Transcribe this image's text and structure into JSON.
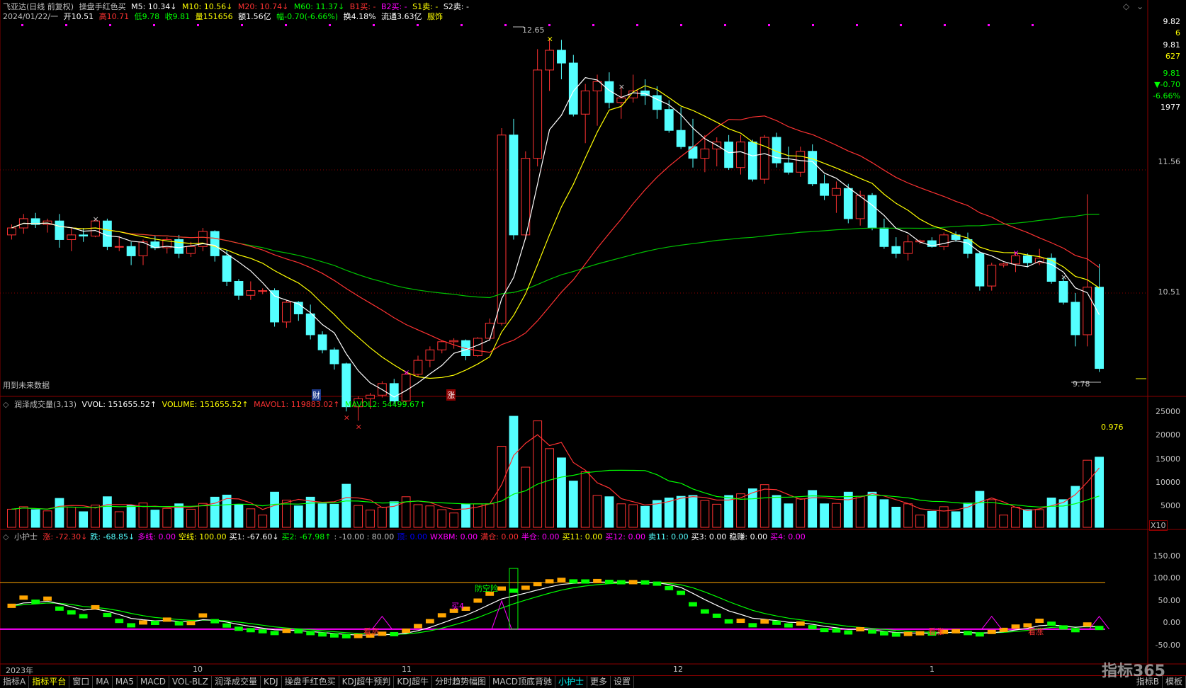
{
  "colors": {
    "up": "#ff3232",
    "down": "#54ffff",
    "ma5": "#ffffff",
    "ma10": "#ffff00",
    "ma20": "#ff3232",
    "ma60": "#00c000",
    "grid": "#8b0000",
    "orange": "#ffa500",
    "green": "#00ff00",
    "magenta": "#ff00ff"
  },
  "header": {
    "stock": "飞亚达(日线 前复权)",
    "indicator_name": "操盘手红色买",
    "ma5": "M5: 10.34↓",
    "ma10": "M10: 10.56↓",
    "ma20": "M20: 10.74↓",
    "ma60": "M60: 11.37↓",
    "b1": "B1买: -",
    "b2": "B2买: -",
    "s1": "S1卖: -",
    "s2": "S2卖: -",
    "date": "2024/01/22/一",
    "open": "开10.51",
    "high": "高10.71",
    "low": "低9.78",
    "close": "收9.81",
    "volume": "量151656",
    "amount": "额1.56亿",
    "change": "幅-0.70(-6.66%)",
    "turnover": "换4.18%",
    "float": "流通3.63亿",
    "sector": "服饰"
  },
  "right_panel": {
    "v1": "9.82",
    "v2": "6",
    "v3": "9.81",
    "v4": "627",
    "v5": "9.81",
    "v6": "▼-0.70",
    "v7": "-6.66%",
    "v8": "1977"
  },
  "price_axis": [
    "11.56",
    "10.51"
  ],
  "annotations": {
    "high_label": "12.65",
    "low_label": "9.78",
    "future_data": "用到未来数据",
    "cai_label": "财",
    "zhang_label": "涨"
  },
  "volume_panel": {
    "title": "润泽成交量(3,13)",
    "vvol": "VVOL: 151655.52↑",
    "volume": "VOLUME: 151655.52↑",
    "mavol1": "MAVOL1: 119883.02↑",
    "mavol2": "MAVOL2: 54499.67↑",
    "ratio": "0.976",
    "axis": [
      "25000",
      "20000",
      "15000",
      "10000",
      "5000"
    ],
    "unit": "X10"
  },
  "guard_panel": {
    "title": "小护士",
    "items": [
      {
        "text": "涨: -72.30↓",
        "color": "#ff3232"
      },
      {
        "text": "跌: -68.85↓",
        "color": "#54ffff"
      },
      {
        "text": "多线: 0.00",
        "color": "#ff00ff"
      },
      {
        "text": "空线: 100.00",
        "color": "#ffff00"
      },
      {
        "text": "买1: -67.60↓",
        "color": "#ffffff"
      },
      {
        "text": "买2: -67.98↑",
        "color": "#00ff00"
      },
      {
        "text": ": -10.00 : 80.00",
        "color": "#c0c0c0"
      },
      {
        "text": "顶: 0.00",
        "color": "#0000ff"
      },
      {
        "text": "WXBM: 0.00",
        "color": "#ff00ff"
      },
      {
        "text": "满仓: 0.00",
        "color": "#ff3232"
      },
      {
        "text": "半仓: 0.00",
        "color": "#ff00ff"
      },
      {
        "text": "买11: 0.00",
        "color": "#ffff00"
      },
      {
        "text": "买12: 0.00",
        "color": "#ff00ff"
      },
      {
        "text": "卖11: 0.00",
        "color": "#54ffff"
      },
      {
        "text": "买3: 0.00",
        "color": "#ffffff"
      },
      {
        "text": "稳赚: 0.00",
        "color": "#ffffff"
      },
      {
        "text": "买4: 0.00",
        "color": "#ff00ff"
      }
    ],
    "axis": [
      "150.00",
      "100.00",
      "50.00",
      "0.00",
      "-50.00"
    ],
    "labels": {
      "kanzhang": "看涨",
      "fangxian": "防空险",
      "jixiang": "买4"
    }
  },
  "date_axis": [
    "2023年",
    "10",
    "11",
    "12",
    "1"
  ],
  "tabs": [
    {
      "label": "指标A"
    },
    {
      "label": "指标平台"
    },
    {
      "label": "窗口"
    },
    {
      "label": "MA"
    },
    {
      "label": "MA5"
    },
    {
      "label": "MACD"
    },
    {
      "label": "VOL-BLZ"
    },
    {
      "label": "润泽成交量"
    },
    {
      "label": "KDJ"
    },
    {
      "label": "操盘手红色买"
    },
    {
      "label": "KDJ超牛预判"
    },
    {
      "label": "KDJ超牛"
    },
    {
      "label": "分时趋势幅图"
    },
    {
      "label": "MACD顶底背驰"
    },
    {
      "label": "小护士"
    },
    {
      "label": "更多"
    },
    {
      "label": "设置"
    }
  ],
  "tabs_right": {
    "b": "指标B",
    "template": "模板"
  },
  "watermark": "指标365",
  "chart_data": {
    "type": "candlestick",
    "price_range": [
      9.6,
      12.8
    ],
    "candles": [
      [
        10.96,
        11.05,
        10.92,
        11.02
      ],
      [
        11.02,
        11.14,
        10.97,
        11.1
      ],
      [
        11.1,
        11.15,
        11.02,
        11.05
      ],
      [
        11.05,
        11.1,
        10.98,
        11.08
      ],
      [
        11.08,
        11.14,
        10.85,
        10.92
      ],
      [
        10.92,
        11.02,
        10.82,
        10.96
      ],
      [
        10.96,
        11.02,
        10.9,
        10.95
      ],
      [
        10.95,
        11.1,
        10.94,
        11.08
      ],
      [
        11.08,
        11.1,
        10.83,
        10.86
      ],
      [
        10.86,
        10.95,
        10.82,
        10.86
      ],
      [
        10.86,
        10.9,
        10.7,
        10.78
      ],
      [
        10.78,
        10.92,
        10.7,
        10.9
      ],
      [
        10.9,
        10.95,
        10.83,
        10.85
      ],
      [
        10.85,
        10.94,
        10.8,
        10.92
      ],
      [
        10.92,
        10.96,
        10.76,
        10.8
      ],
      [
        10.8,
        10.9,
        10.77,
        10.86
      ],
      [
        10.86,
        11.02,
        10.82,
        10.99
      ],
      [
        10.99,
        11.0,
        10.73,
        10.78
      ],
      [
        10.78,
        10.83,
        10.52,
        10.56
      ],
      [
        10.56,
        10.58,
        10.4,
        10.44
      ],
      [
        10.44,
        10.56,
        10.4,
        10.48
      ],
      [
        10.48,
        10.5,
        10.45,
        10.48
      ],
      [
        10.48,
        10.5,
        10.17,
        10.21
      ],
      [
        10.21,
        10.4,
        10.16,
        10.38
      ],
      [
        10.38,
        10.39,
        10.22,
        10.28
      ],
      [
        10.28,
        10.36,
        10.06,
        10.1
      ],
      [
        10.1,
        10.13,
        9.94,
        9.97
      ],
      [
        9.97,
        9.99,
        9.8,
        9.85
      ],
      [
        9.85,
        9.86,
        9.44,
        9.48
      ],
      [
        9.48,
        9.57,
        9.36,
        9.55
      ],
      [
        9.55,
        9.6,
        9.46,
        9.58
      ],
      [
        9.58,
        9.7,
        9.56,
        9.68
      ],
      [
        9.68,
        9.72,
        9.5,
        9.53
      ],
      [
        9.53,
        9.78,
        9.52,
        9.76
      ],
      [
        9.76,
        9.92,
        9.74,
        9.88
      ],
      [
        9.88,
        10.0,
        9.82,
        9.97
      ],
      [
        9.97,
        10.05,
        9.94,
        10.04
      ],
      [
        10.04,
        10.07,
        9.98,
        10.05
      ],
      [
        10.05,
        10.06,
        9.88,
        9.92
      ],
      [
        9.92,
        10.08,
        9.91,
        10.07
      ],
      [
        10.07,
        10.24,
        10.05,
        10.2
      ],
      [
        10.2,
        11.88,
        10.18,
        11.82
      ],
      [
        11.82,
        11.96,
        10.92,
        10.96
      ],
      [
        10.96,
        11.68,
        10.92,
        11.62
      ],
      [
        11.62,
        12.56,
        11.55,
        12.38
      ],
      [
        12.38,
        12.65,
        12.2,
        12.55
      ],
      [
        12.55,
        12.64,
        12.3,
        12.44
      ],
      [
        12.44,
        12.51,
        11.98,
        12.0
      ],
      [
        12.0,
        12.26,
        11.75,
        12.2
      ],
      [
        12.2,
        12.34,
        11.9,
        12.28
      ],
      [
        12.28,
        12.36,
        12.05,
        12.1
      ],
      [
        12.1,
        12.24,
        11.96,
        12.14
      ],
      [
        12.14,
        12.34,
        12.1,
        12.2
      ],
      [
        12.2,
        12.3,
        12.08,
        12.16
      ],
      [
        12.16,
        12.24,
        11.96,
        12.04
      ],
      [
        12.04,
        12.12,
        11.84,
        11.86
      ],
      [
        11.86,
        12.06,
        11.7,
        11.72
      ],
      [
        11.72,
        11.96,
        11.54,
        11.62
      ],
      [
        11.62,
        11.82,
        11.5,
        11.7
      ],
      [
        11.7,
        11.8,
        11.55,
        11.76
      ],
      [
        11.76,
        11.82,
        11.52,
        11.54
      ],
      [
        11.54,
        11.82,
        11.48,
        11.76
      ],
      [
        11.76,
        11.78,
        11.42,
        11.44
      ],
      [
        11.44,
        11.82,
        11.4,
        11.8
      ],
      [
        11.8,
        11.84,
        11.54,
        11.58
      ],
      [
        11.58,
        11.72,
        11.48,
        11.5
      ],
      [
        11.5,
        11.72,
        11.46,
        11.68
      ],
      [
        11.68,
        11.74,
        11.38,
        11.4
      ],
      [
        11.4,
        11.48,
        11.26,
        11.3
      ],
      [
        11.3,
        11.42,
        11.15,
        11.36
      ],
      [
        11.36,
        11.4,
        11.06,
        11.1
      ],
      [
        11.1,
        11.34,
        11.04,
        11.3
      ],
      [
        11.3,
        11.32,
        11.0,
        11.02
      ],
      [
        11.02,
        11.1,
        10.84,
        10.86
      ],
      [
        10.86,
        10.94,
        10.76,
        10.8
      ],
      [
        10.8,
        10.96,
        10.74,
        10.9
      ],
      [
        10.9,
        10.92,
        10.88,
        10.91
      ],
      [
        10.91,
        10.94,
        10.85,
        10.86
      ],
      [
        10.86,
        10.98,
        10.83,
        10.96
      ],
      [
        10.96,
        10.99,
        10.9,
        10.92
      ],
      [
        10.92,
        10.98,
        10.76,
        10.8
      ],
      [
        10.8,
        10.82,
        10.48,
        10.52
      ],
      [
        10.52,
        10.72,
        10.48,
        10.7
      ],
      [
        10.7,
        10.72,
        10.68,
        10.71
      ],
      [
        10.71,
        10.81,
        10.64,
        10.78
      ],
      [
        10.78,
        10.8,
        10.68,
        10.72
      ],
      [
        10.72,
        10.84,
        10.7,
        10.76
      ],
      [
        10.76,
        10.8,
        10.54,
        10.56
      ],
      [
        10.56,
        10.6,
        10.36,
        10.38
      ],
      [
        10.38,
        10.46,
        10.0,
        10.1
      ],
      [
        10.1,
        11.31,
        10.0,
        10.51
      ],
      [
        10.51,
        10.71,
        9.78,
        9.81
      ]
    ]
  }
}
